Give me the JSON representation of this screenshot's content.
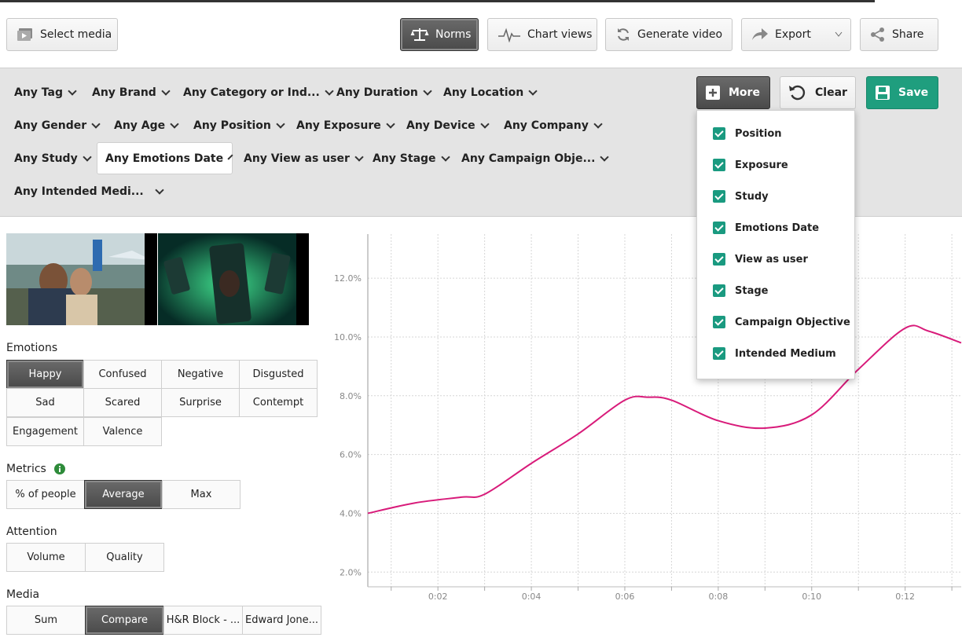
{
  "toolbar": {
    "select_media": "Select media",
    "norms": "Norms",
    "chart_views": "Chart views",
    "generate_video": "Generate video",
    "export": "Export",
    "share": "Share"
  },
  "filters": {
    "row1": [
      "Any Tag",
      "Any Brand",
      "Any Category or Ind...",
      "Any Duration",
      "Any Location"
    ],
    "row2": [
      "Any Gender",
      "Any Age",
      "Any Position",
      "Any Exposure",
      "Any Device",
      "Any Company"
    ],
    "row3": [
      "Any Study",
      "Any Emotions Date",
      "Any View as user",
      "Any Stage",
      "Any Campaign Obje..."
    ],
    "row4": [
      "Any Intended Medi..."
    ],
    "more": "More",
    "clear": "Clear",
    "save": "Save"
  },
  "more_dropdown": {
    "items": [
      "Position",
      "Exposure",
      "Study",
      "Emotions Date",
      "View as user",
      "Stage",
      "Campaign Objective",
      "Intended Medium"
    ],
    "checked": [
      true,
      true,
      true,
      true,
      true,
      true,
      true,
      true
    ]
  },
  "emotions": {
    "title": "Emotions",
    "options": [
      "Happy",
      "Confused",
      "Negative",
      "Disgusted",
      "Sad",
      "Scared",
      "Surprise",
      "Contempt",
      "Engagement",
      "Valence"
    ],
    "selected": "Happy"
  },
  "metrics": {
    "title": "Metrics",
    "options": [
      "% of people",
      "Average",
      "Max"
    ],
    "selected": "Average"
  },
  "attention": {
    "title": "Attention",
    "options": [
      "Volume",
      "Quality"
    ]
  },
  "media": {
    "title": "Media",
    "options": [
      "Sum",
      "Compare",
      "H&R Block - ...",
      "Edward Jone..."
    ],
    "selected": "Compare"
  },
  "colors": {
    "accent_green": "#1f9e7e",
    "line": "#d81b7a"
  },
  "chart_data": {
    "type": "line",
    "x_ticks": [
      "0:02",
      "0:04",
      "0:06",
      "0:08",
      "0:10",
      "0:12"
    ],
    "y_ticks": [
      "2.0%",
      "4.0%",
      "6.0%",
      "8.0%",
      "10.0%",
      "12.0%"
    ],
    "ylim": [
      1.5,
      13.5
    ],
    "xlim": [
      0.5,
      13.2
    ],
    "grid": true,
    "series": [
      {
        "color": "#d81b7a",
        "x": [
          0.5,
          1.5,
          2.5,
          3.0,
          4.0,
          5.0,
          6.0,
          6.5,
          7.0,
          8.0,
          9.0,
          10.0,
          11.0,
          12.0,
          12.5,
          13.2
        ],
        "y": [
          4.0,
          4.35,
          4.55,
          4.65,
          5.7,
          6.7,
          7.85,
          7.95,
          7.85,
          7.15,
          6.9,
          7.35,
          8.9,
          10.3,
          10.2,
          9.8
        ]
      }
    ]
  }
}
